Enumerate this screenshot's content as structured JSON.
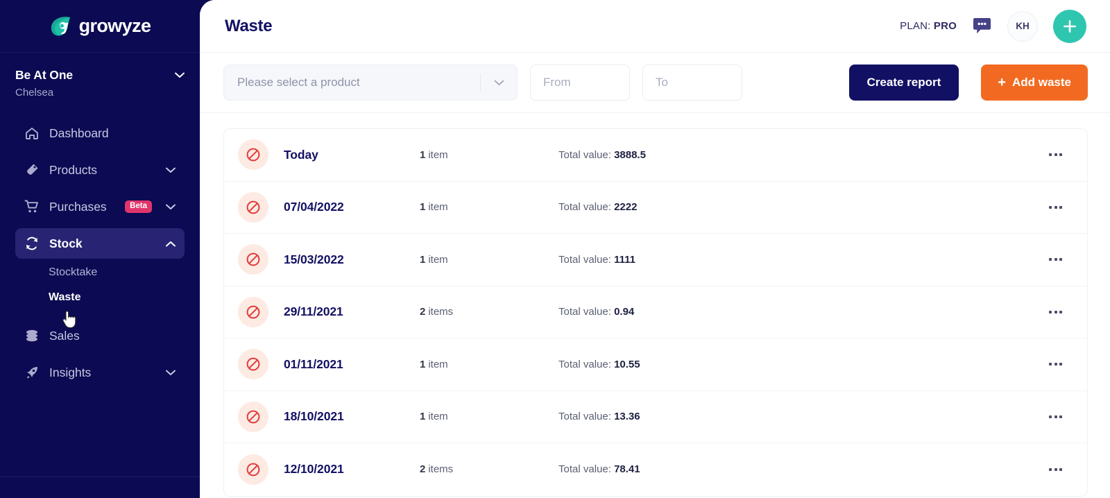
{
  "brand": {
    "name": "growyze",
    "logo_icon": "growyze-leaf-logo"
  },
  "sidebar": {
    "org": {
      "name": "Be At One",
      "location": "Chelsea",
      "chevron_icon": "chevron-down-icon"
    },
    "items": [
      {
        "label": "Dashboard",
        "icon": "home-icon",
        "active": false,
        "expandable": false
      },
      {
        "label": "Products",
        "icon": "bottle-tag-icon",
        "active": false,
        "expandable": true
      },
      {
        "label": "Purchases",
        "icon": "shopping-cart-icon",
        "active": false,
        "expandable": true,
        "badge": "Beta"
      },
      {
        "label": "Stock",
        "icon": "refresh-sync-icon",
        "active": true,
        "expandable": true
      },
      {
        "label": "Sales",
        "icon": "coins-stack-icon",
        "active": false,
        "expandable": false
      },
      {
        "label": "Insights",
        "icon": "rocket-icon",
        "active": false,
        "expandable": true
      }
    ],
    "stock_subitems": [
      {
        "label": "Stocktake",
        "current": false
      },
      {
        "label": "Waste",
        "current": true
      }
    ]
  },
  "header": {
    "title": "Waste",
    "plan_label": "PLAN:",
    "plan_value": "PRO",
    "chat_icon": "chat-bubble-icon",
    "avatar_initials": "KH",
    "add_button_icon": "plus-icon"
  },
  "toolbar": {
    "product_select_placeholder": "Please select a product",
    "product_select_value": "",
    "select_chevron_icon": "chevron-down-icon",
    "date_from_placeholder": "From",
    "date_from_value": "",
    "date_to_placeholder": "To",
    "date_to_value": "",
    "create_report_label": "Create report",
    "add_waste_label": "Add waste",
    "add_waste_icon": "plus-icon"
  },
  "list": {
    "total_value_label": "Total value:",
    "status_icon": "ban-prohibited-icon",
    "row_menu_icon": "ellipsis-horizontal-icon",
    "rows": [
      {
        "date": "Today",
        "count": "1",
        "count_unit": "item",
        "total": "3888.5"
      },
      {
        "date": "07/04/2022",
        "count": "1",
        "count_unit": "item",
        "total": "2222"
      },
      {
        "date": "15/03/2022",
        "count": "1",
        "count_unit": "item",
        "total": "1111"
      },
      {
        "date": "29/11/2021",
        "count": "2",
        "count_unit": "items",
        "total": "0.94"
      },
      {
        "date": "01/11/2021",
        "count": "1",
        "count_unit": "item",
        "total": "10.55"
      },
      {
        "date": "18/10/2021",
        "count": "1",
        "count_unit": "item",
        "total": "13.36"
      },
      {
        "date": "12/10/2021",
        "count": "2",
        "count_unit": "items",
        "total": "78.41"
      }
    ]
  },
  "colors": {
    "sidebar_bg": "#0b0a52",
    "sidebar_active": "#282473",
    "brand_teal": "#2fc6b0",
    "accent_orange": "#f26a21",
    "dark_navy": "#121063",
    "badge_pink": "#e0356b",
    "status_red": "#e13c3c",
    "status_bg": "#fdeae2"
  }
}
